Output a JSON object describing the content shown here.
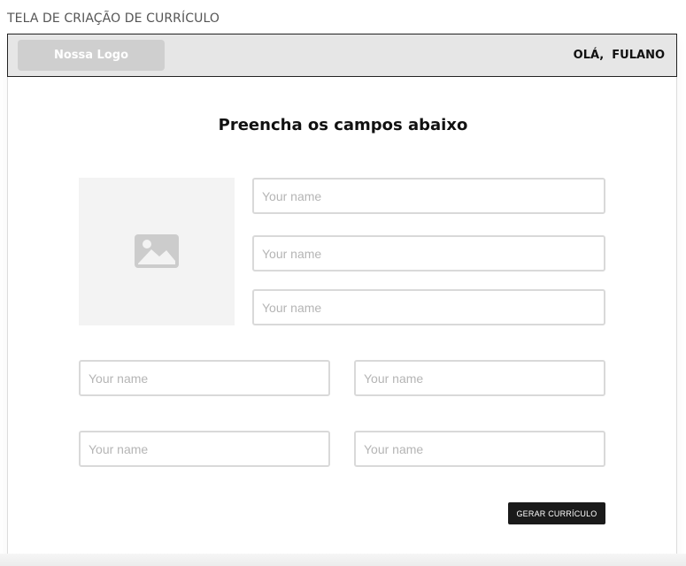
{
  "screen": {
    "title": "TELA DE CRIAÇÃO DE CURRÍCULO"
  },
  "header": {
    "logo_label": "Nossa Logo",
    "greeting": "OLÁ,  FULANO",
    "background_color": "#e6e6e6",
    "logo_color": "#cfcfcf"
  },
  "form": {
    "heading": "Preencha os campos abaixo",
    "photo_placeholder_icon": "image-icon",
    "fields": [
      {
        "placeholder": "Your name",
        "value": ""
      },
      {
        "placeholder": "Your name",
        "value": ""
      },
      {
        "placeholder": "Your name",
        "value": ""
      },
      {
        "placeholder": "Your name",
        "value": ""
      },
      {
        "placeholder": "Your name",
        "value": ""
      },
      {
        "placeholder": "Your name",
        "value": ""
      },
      {
        "placeholder": "Your name",
        "value": ""
      }
    ],
    "submit_label": "GERAR CURRÍCULO",
    "submit_color": "#1a1a1a"
  }
}
